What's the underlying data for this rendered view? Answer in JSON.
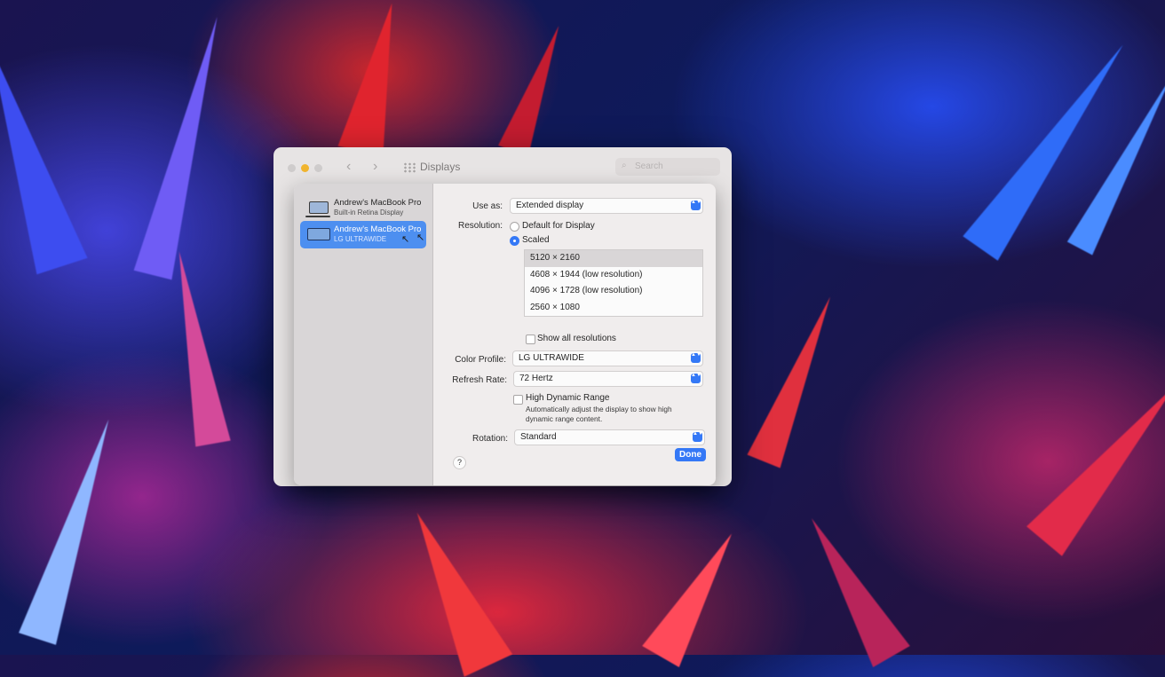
{
  "window": {
    "title": "Displays",
    "search_placeholder": "Search"
  },
  "icons": {
    "back": "‹",
    "forward": "›",
    "search": "⌕",
    "cursor": "↖",
    "chevron_updown": "▲▼"
  },
  "displays": [
    {
      "name": "Andrew's MacBook Pro",
      "subtitle": "Built-in Retina Display",
      "selected": false
    },
    {
      "name": "Andrew's MacBook Pro",
      "subtitle": "LG ULTRAWIDE",
      "selected": true
    }
  ],
  "settings": {
    "use_as": {
      "label": "Use as:",
      "value": "Extended display"
    },
    "resolution": {
      "label": "Resolution:",
      "options": [
        {
          "label": "Default for Display",
          "selected": false
        },
        {
          "label": "Scaled",
          "selected": true
        }
      ],
      "list": [
        {
          "label": "5120 × 2160",
          "selected": true
        },
        {
          "label": "4608 × 1944 (low resolution)",
          "selected": false
        },
        {
          "label": "4096 × 1728 (low resolution)",
          "selected": false
        },
        {
          "label": "2560 × 1080",
          "selected": false
        }
      ],
      "show_all_label": "Show all resolutions"
    },
    "color_profile": {
      "label": "Color Profile:",
      "value": "LG ULTRAWIDE"
    },
    "refresh_rate": {
      "label": "Refresh Rate:",
      "value": "72 Hertz"
    },
    "hdr": {
      "label": "High Dynamic Range",
      "description": "Automatically adjust the display to show high dynamic range content."
    },
    "rotation": {
      "label": "Rotation:",
      "value": "Standard"
    }
  },
  "buttons": {
    "help": "?",
    "done": "Done"
  },
  "colors": {
    "accent": "#3478f6",
    "sidebar_selected": "#4d8ff0"
  }
}
